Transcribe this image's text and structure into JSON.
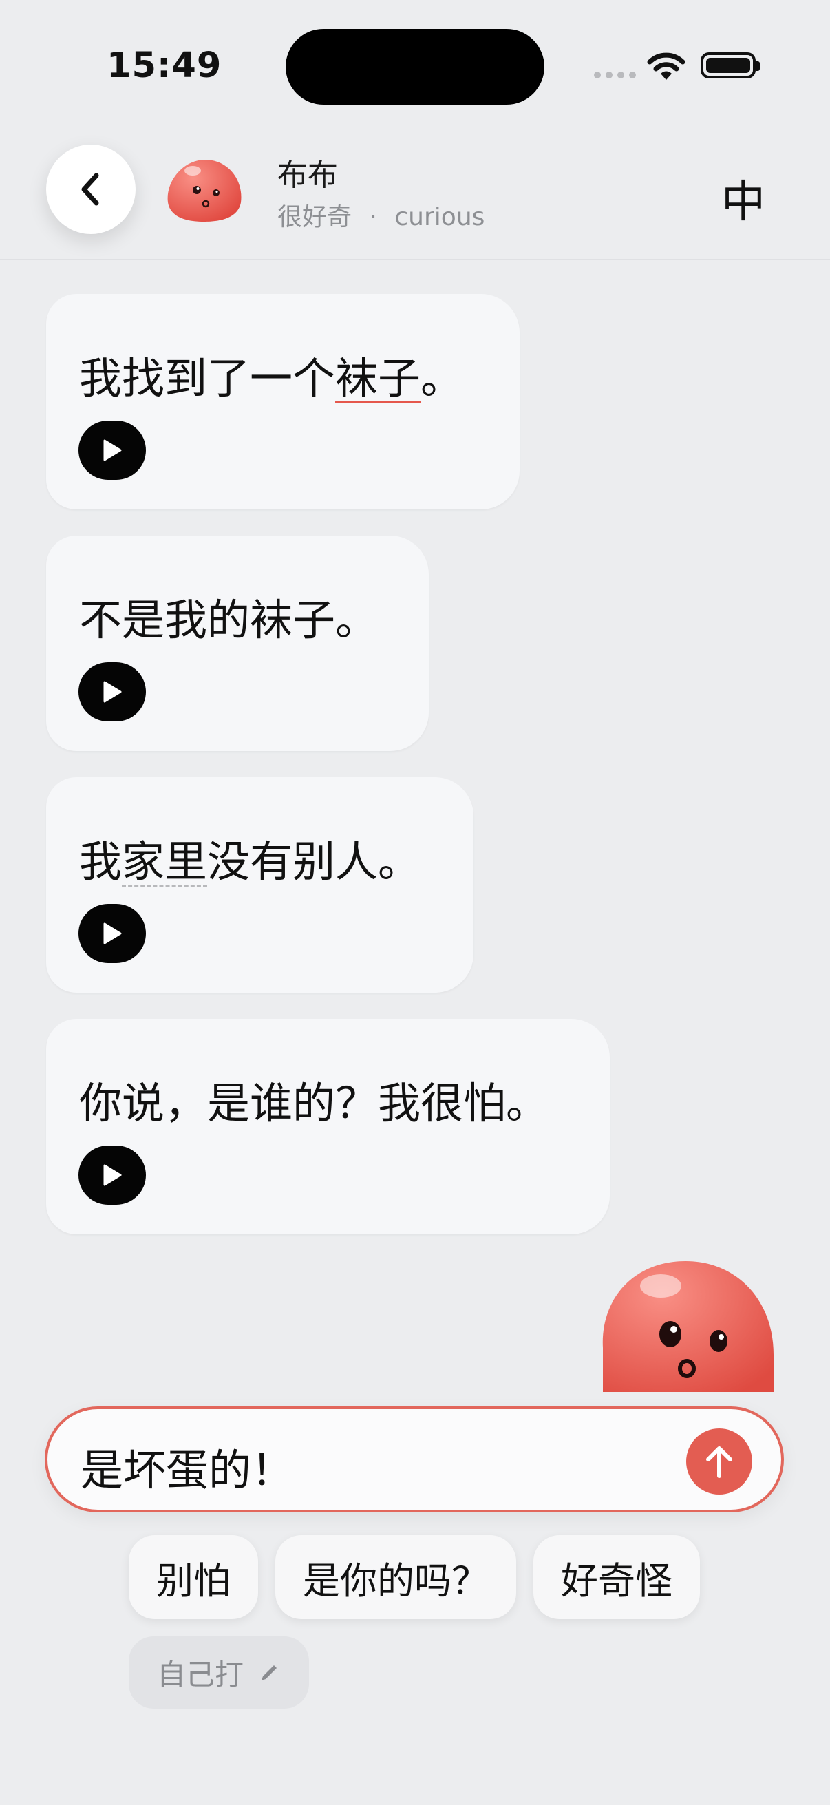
{
  "status_bar": {
    "time": "15:49",
    "signal_icon": "cellular-dots-icon",
    "wifi_icon": "wifi-icon",
    "battery_icon": "battery-full-icon"
  },
  "header": {
    "back_icon": "chevron-left-icon",
    "avatar": "red-blob-character",
    "name": "布布",
    "mood_cn": "很好奇",
    "separator": "·",
    "mood_en": "curious",
    "lang_toggle": "中"
  },
  "messages": [
    {
      "before": "我找到了一个",
      "highlight": "袜子",
      "after": "。",
      "highlight_style": "underline-red"
    },
    {
      "text": "不是我的袜子。"
    },
    {
      "before": "我",
      "highlight": "家里",
      "after": "没有别人。",
      "highlight_style": "dotted-gray"
    },
    {
      "text": "你说，是谁的？我很怕。"
    }
  ],
  "play_icon": "play-icon",
  "composer": {
    "text": "是坏蛋的！",
    "send_icon": "arrow-up-icon"
  },
  "suggestions": [
    "别怕",
    "是你的吗？",
    "好奇怪"
  ],
  "self_type": {
    "label": "自己打",
    "icon": "pencil-icon"
  },
  "colors": {
    "accent": "#e35d52",
    "bubble": "#f6f7f9",
    "background": "#ecedef",
    "underline": "#e5584d"
  }
}
